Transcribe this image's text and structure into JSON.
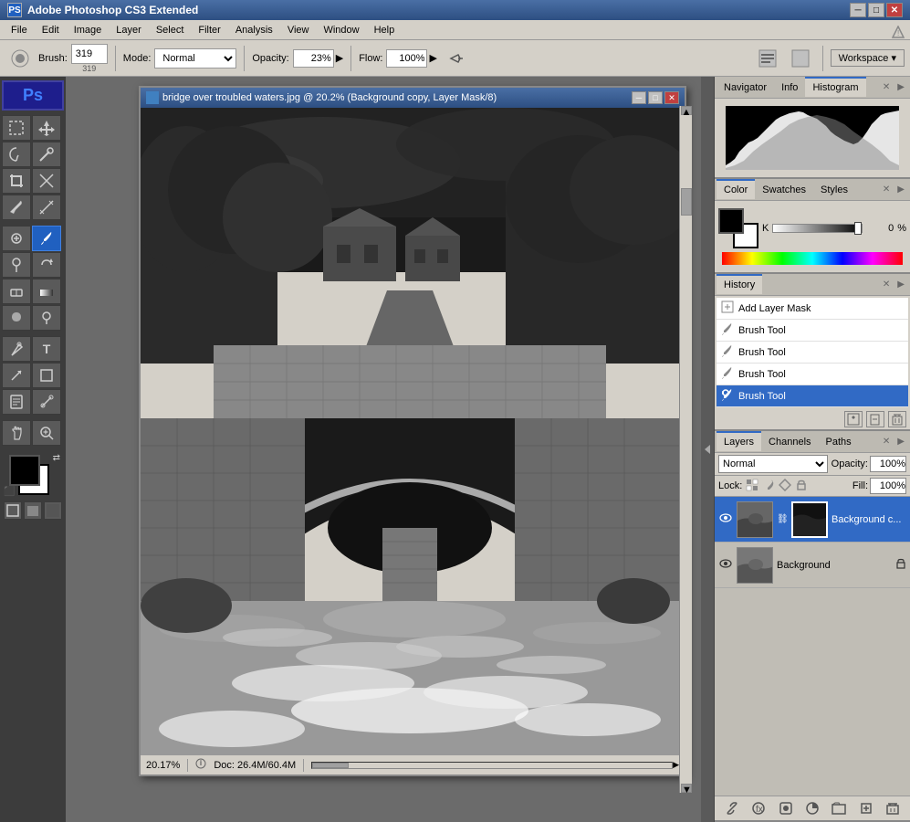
{
  "app": {
    "title": "Adobe Photoshop CS3 Extended",
    "icon": "PS"
  },
  "titlebar": {
    "title": "Adobe Photoshop CS3 Extended",
    "minimize": "─",
    "maximize": "□",
    "close": "✕"
  },
  "menubar": {
    "items": [
      "File",
      "Edit",
      "Image",
      "Layer",
      "Select",
      "Filter",
      "Analysis",
      "View",
      "Window",
      "Help"
    ]
  },
  "toolbar": {
    "brush_label": "Brush:",
    "brush_size": "319",
    "mode_label": "Mode:",
    "mode_value": "Normal",
    "opacity_label": "Opacity:",
    "opacity_value": "23%",
    "flow_label": "Flow:",
    "flow_value": "100%",
    "workspace_label": "Workspace ▾"
  },
  "image_window": {
    "title": "bridge over troubled waters.jpg @ 20.2% (Background copy, Layer Mask/8)",
    "status_zoom": "20.17%",
    "status_doc": "Doc: 26.4M/60.4M"
  },
  "panels": {
    "top": {
      "tabs": [
        "Navigator",
        "Info",
        "Histogram"
      ],
      "active_tab": "Histogram"
    },
    "color": {
      "tabs": [
        "Color",
        "Swatches",
        "Styles"
      ],
      "active_tab": "Color",
      "k_label": "K",
      "k_value": "0",
      "k_unit": "%"
    },
    "history": {
      "tabs": [
        "History"
      ],
      "active_tab": "History",
      "items": [
        {
          "label": "Add Layer Mask",
          "icon": "🎭",
          "active": false
        },
        {
          "label": "Brush Tool",
          "icon": "🖌",
          "active": false
        },
        {
          "label": "Brush Tool",
          "icon": "🖌",
          "active": false
        },
        {
          "label": "Brush Tool",
          "icon": "🖌",
          "active": false
        },
        {
          "label": "Brush Tool",
          "icon": "🖌",
          "active": true
        }
      ]
    },
    "layers": {
      "tabs": [
        "Layers",
        "Channels",
        "Paths"
      ],
      "active_tab": "Layers",
      "blend_mode": "Normal",
      "opacity_label": "Opacity:",
      "opacity_value": "100%",
      "lock_label": "Lock:",
      "fill_label": "Fill:",
      "fill_value": "100%",
      "layers": [
        {
          "name": "Background c...",
          "visible": true,
          "active": true,
          "has_mask": true,
          "locked": false
        },
        {
          "name": "Background",
          "visible": true,
          "active": false,
          "has_mask": false,
          "locked": true
        }
      ]
    }
  },
  "toolbox": {
    "tools": [
      {
        "icon": "↖",
        "label": "move-tool"
      },
      {
        "icon": "⬚",
        "label": "selection-tool"
      },
      {
        "icon": "✂",
        "label": "lasso-tool"
      },
      {
        "icon": "🔮",
        "label": "magic-wand-tool"
      },
      {
        "icon": "✂",
        "label": "crop-tool"
      },
      {
        "icon": "⊕",
        "label": "eyedropper-tool"
      },
      {
        "icon": "⊙",
        "label": "healing-tool"
      },
      {
        "icon": "🖌",
        "label": "brush-tool"
      },
      {
        "icon": "▦",
        "label": "stamp-tool"
      },
      {
        "icon": "↺",
        "label": "history-brush-tool"
      },
      {
        "icon": "◫",
        "label": "eraser-tool"
      },
      {
        "icon": "░",
        "label": "gradient-tool"
      },
      {
        "icon": "⬤",
        "label": "dodge-tool"
      },
      {
        "icon": "✏",
        "label": "pen-tool"
      },
      {
        "icon": "T",
        "label": "type-tool"
      },
      {
        "icon": "↗",
        "label": "path-selection-tool"
      },
      {
        "icon": "□",
        "label": "shape-tool"
      },
      {
        "icon": "🔍",
        "label": "notes-tool"
      },
      {
        "icon": "👋",
        "label": "hand-tool"
      },
      {
        "icon": "🔍",
        "label": "zoom-tool"
      }
    ]
  }
}
